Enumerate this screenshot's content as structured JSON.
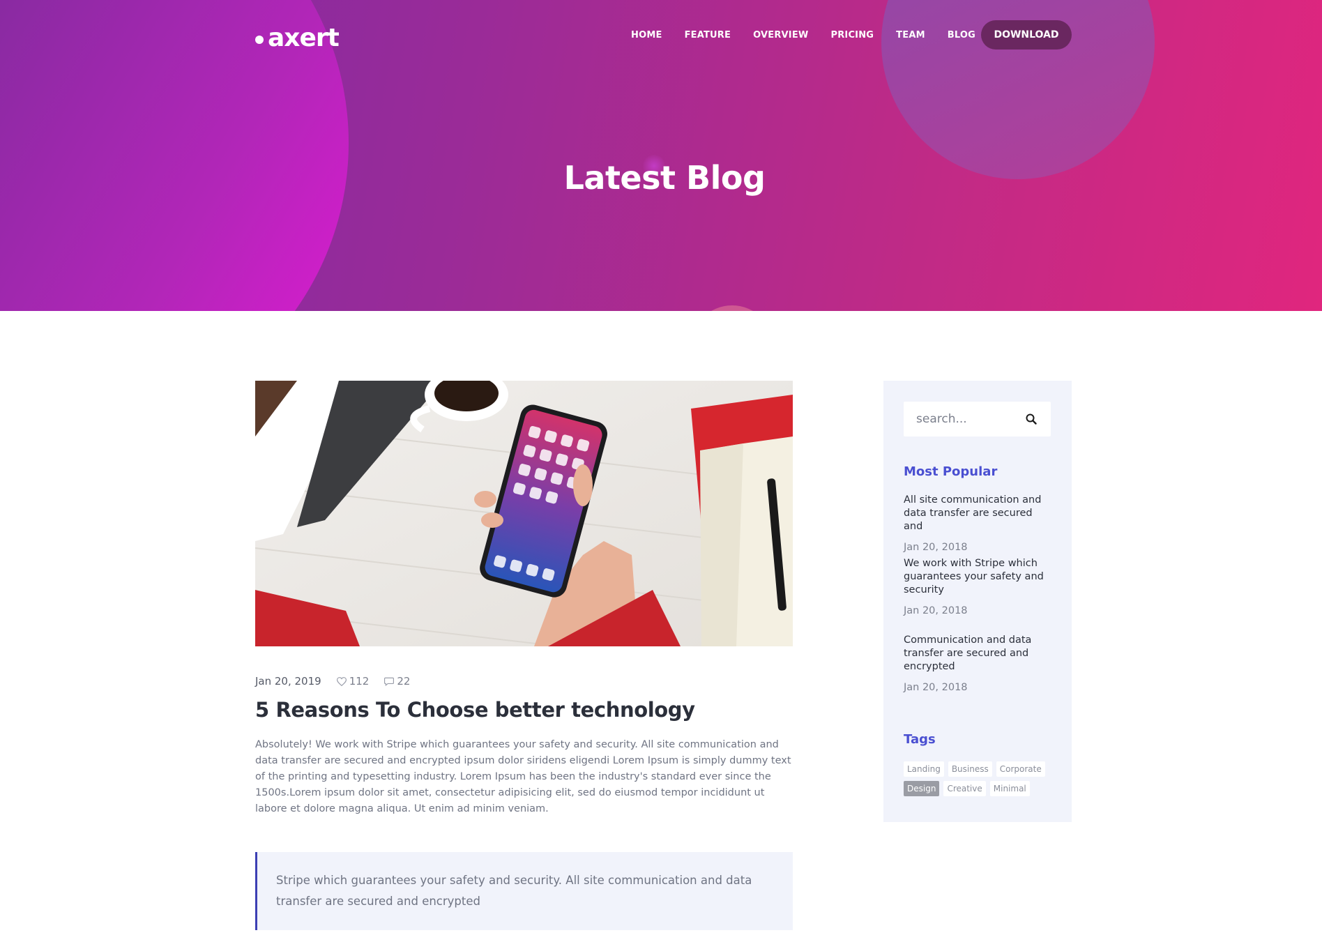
{
  "brand": {
    "logo_text": "axert"
  },
  "nav": {
    "items": [
      "HOME",
      "FEATURE",
      "OVERVIEW",
      "PRICING",
      "TEAM",
      "BLOG"
    ],
    "download_label": "DOWNLOAD"
  },
  "hero": {
    "title": "Latest Blog"
  },
  "post": {
    "date": "Jan 20, 2019",
    "likes": "112",
    "comments": "22",
    "title": "5 Reasons To Choose better technology",
    "excerpt": "Absolutely! We work with Stripe which guarantees your safety and security. All site communication and data transfer are secured and encrypted ipsum dolor siridens eligendi Lorem Ipsum is simply dummy text of the printing and typesetting industry. Lorem Ipsum has been the industry's standard ever since the 1500s.Lorem ipsum dolor sit amet, consectetur adipisicing elit, sed do eiusmod tempor incididunt ut labore et dolore magna aliqua. Ut enim ad minim veniam.",
    "quote": "Stripe which guarantees your safety and security. All site communication and data transfer are secured and encrypted"
  },
  "sidebar": {
    "search_placeholder": "search...",
    "popular_title": "Most Popular",
    "popular": [
      {
        "title": "All site communication and data transfer are secured and",
        "date": "Jan 20, 2018"
      },
      {
        "title": "We work with Stripe which guarantees your safety and security",
        "date": "Jan 20, 2018"
      },
      {
        "title": "Communication and data transfer are secured and encrypted",
        "date": "Jan 20, 2018"
      }
    ],
    "tags_title": "Tags",
    "tags": [
      "Landing",
      "Business",
      "Corporate",
      "Design",
      "Creative",
      "Minimal"
    ],
    "active_tag": "Design"
  },
  "colors": {
    "hero_gradient_start": "#7a2aa6",
    "hero_gradient_end": "#e0267e",
    "accent_blue": "#4a4fd1",
    "download_button": "#6a2760",
    "sidebar_bg": "#f1f3fb"
  }
}
